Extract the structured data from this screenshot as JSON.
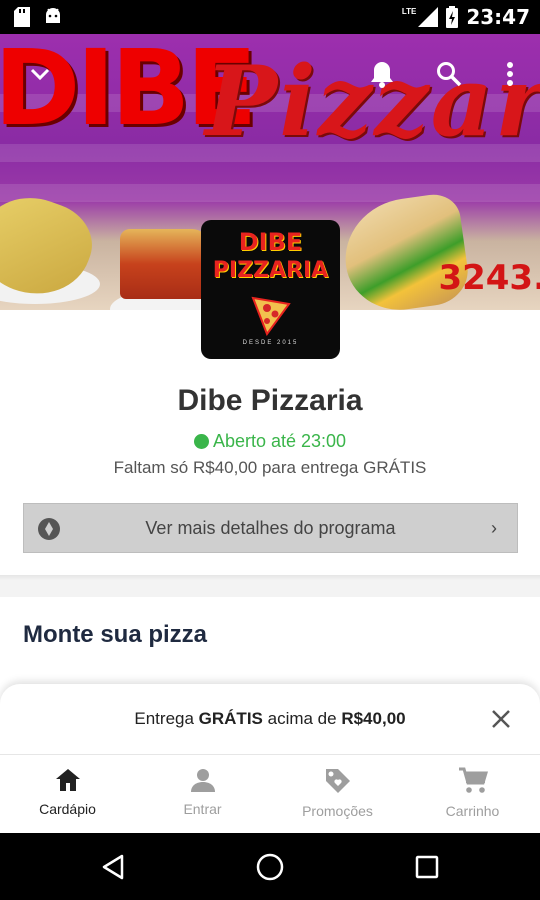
{
  "status_bar": {
    "time": "23:47",
    "network": "LTE"
  },
  "banner": {
    "title_word1": "DIBE",
    "title_word2": "Pizzaria",
    "phone_partial": "3243."
  },
  "logo": {
    "line1": "DIBE",
    "line2": "PIZZARIA",
    "line3": "DESDE 2015"
  },
  "restaurant": {
    "name": "Dibe Pizzaria",
    "status": "Aberto até 23:00",
    "free_delivery_msg": "Faltam só R$40,00 para entrega GRÁTIS"
  },
  "details_button": {
    "label": "Ver mais detalhes do programa"
  },
  "section": {
    "title": "Monte sua pizza"
  },
  "toast": {
    "prefix": "Entrega ",
    "bold1": "GRÁTIS",
    "middle": " acima de ",
    "bold2": "R$40,00"
  },
  "bottom_nav": {
    "items": [
      {
        "label": "Cardápio",
        "icon": "home-icon",
        "active": true
      },
      {
        "label": "Entrar",
        "icon": "person-icon",
        "active": false
      },
      {
        "label": "Promoções",
        "icon": "tag-icon",
        "active": false
      },
      {
        "label": "Carrinho",
        "icon": "cart-icon",
        "active": false
      }
    ]
  },
  "colors": {
    "open_green": "#3ab54a",
    "banner_purple": "#9d2fae",
    "brand_red": "#e00000"
  }
}
